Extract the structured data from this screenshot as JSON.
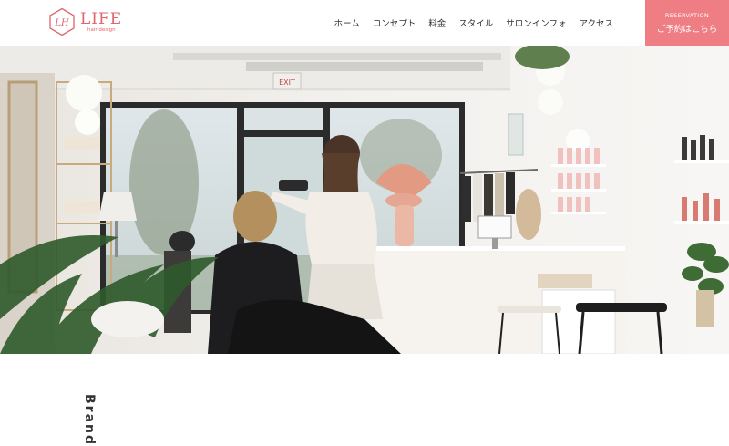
{
  "header": {
    "logo": {
      "name": "LIFE",
      "tagline": "hair design",
      "mark": "LH"
    },
    "nav": [
      {
        "label": "ホーム"
      },
      {
        "label": "コンセプト"
      },
      {
        "label": "料金"
      },
      {
        "label": "スタイル"
      },
      {
        "label": "サロンインフォ"
      },
      {
        "label": "アクセス"
      }
    ],
    "reservation": {
      "en": "RESERVATION",
      "jp": "ご予約はこちら"
    }
  },
  "hero": {
    "exit_sign": "EXIT"
  },
  "section": {
    "vertical_heading": "Brand"
  },
  "colors": {
    "accent": "#ee7e83",
    "logo": "#e1646b"
  }
}
